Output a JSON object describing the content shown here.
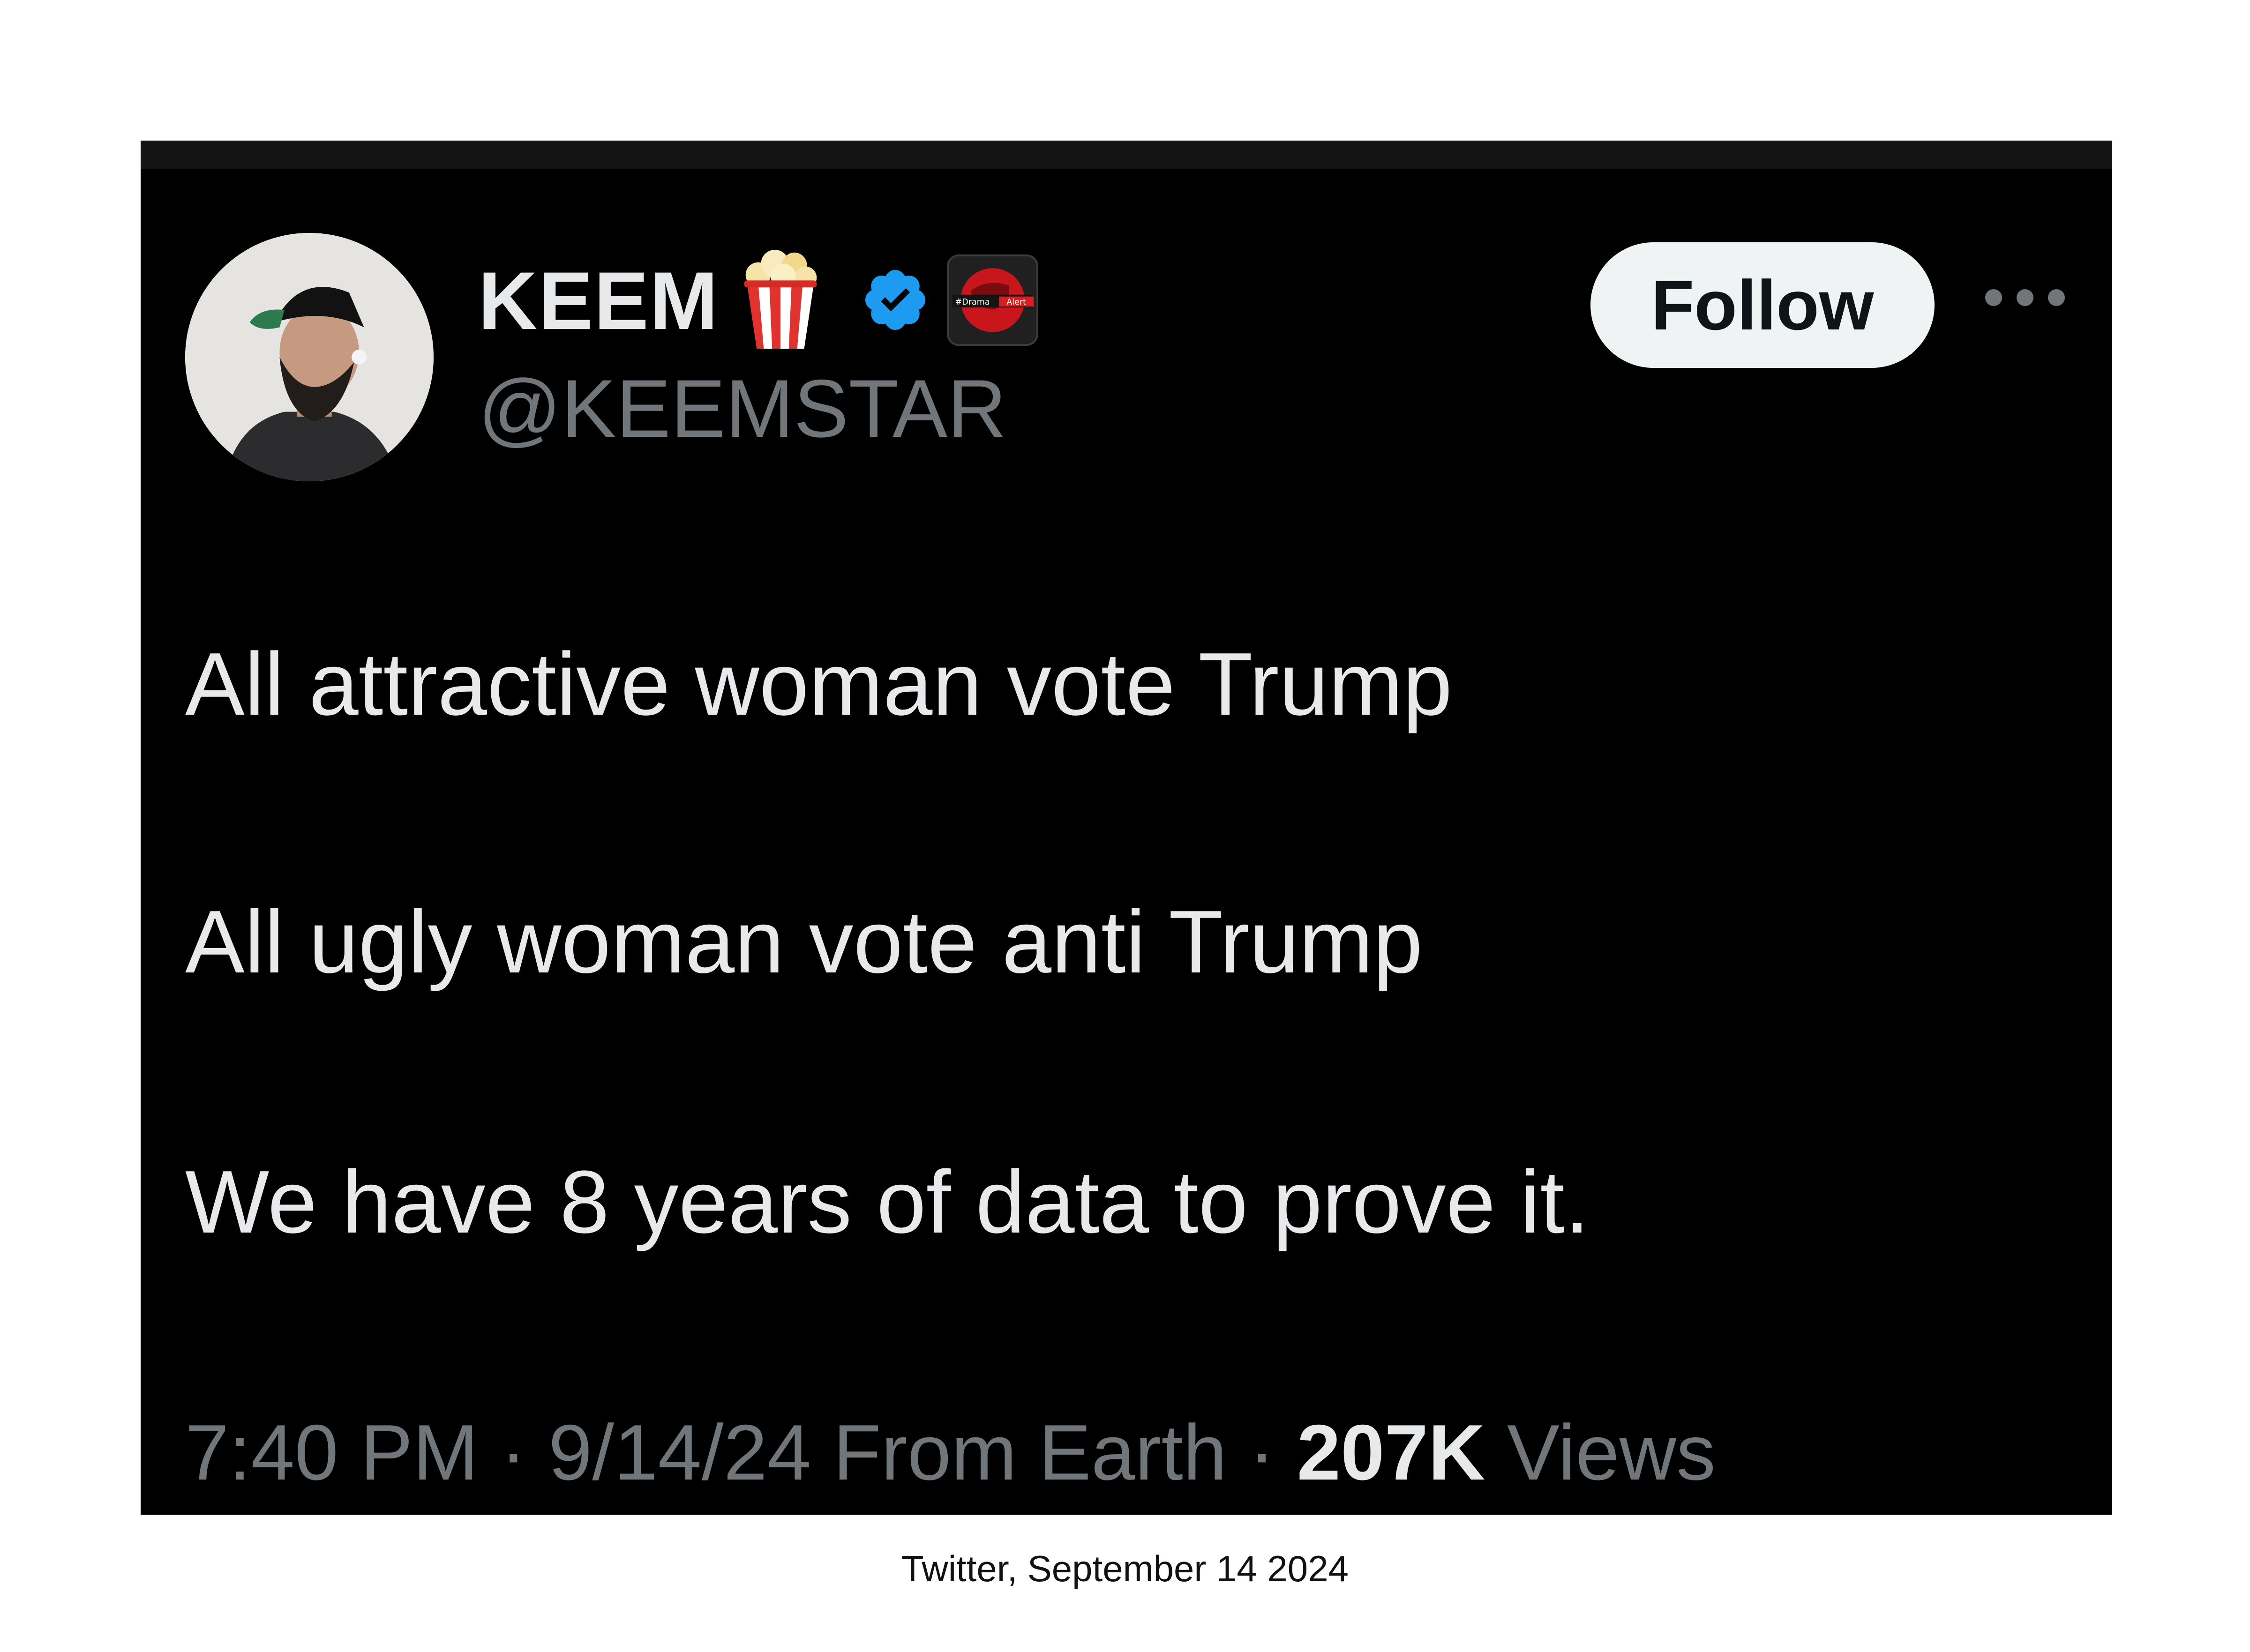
{
  "tweet": {
    "author": {
      "display_name": "KEEM",
      "handle": "@KEEMSTAR",
      "badges": [
        "popcorn-icon",
        "verified-icon",
        "dramaalert-icon"
      ],
      "dramaalert_badge_text": "#DramaAlert"
    },
    "follow_label": "Follow",
    "more_icon": "more-options-icon",
    "lines": [
      "All attractive woman vote Trump",
      "All ugly woman vote anti Trump",
      "We have 8 years of data to prove it."
    ],
    "meta": {
      "time": "7:40 PM",
      "sep1": " · ",
      "date": "9/14/24",
      "location": " From Earth",
      "sep2": " · ",
      "views_count": "207K",
      "views_label": " Views"
    }
  },
  "caption": "Twitter, September 14 2024",
  "colors": {
    "card_bg": "#000000",
    "text_primary": "#e7e9ea",
    "text_secondary": "#71767b",
    "follow_bg": "#eff3f4",
    "verified_blue": "#1d9bf0",
    "page_bg": "#ffffff"
  }
}
